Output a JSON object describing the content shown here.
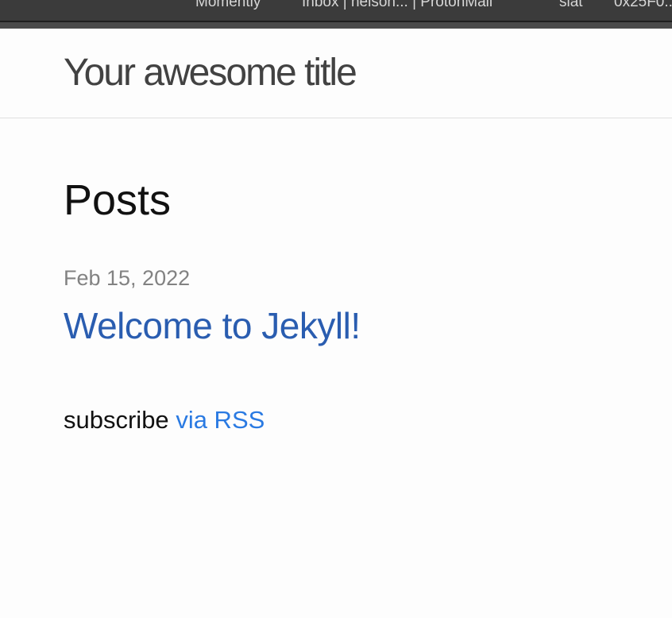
{
  "browser": {
    "bookmarks": [
      "Momently",
      "Inbox | nelson... | ProtonMail",
      "slat",
      "0x25F0..."
    ]
  },
  "header": {
    "site_title": "Your awesome title"
  },
  "main": {
    "heading": "Posts",
    "posts": [
      {
        "date": "Feb 15, 2022",
        "title": "Welcome to Jekyll!"
      }
    ],
    "rss": {
      "prefix": "subscribe",
      "link_label": "via RSS"
    }
  },
  "colors": {
    "title_text": "#424242",
    "post_link": "#2a5db0",
    "rss_link": "#2a7ae2",
    "meta_text": "#828282",
    "bookmarks_bar": "#3b3b3b"
  }
}
